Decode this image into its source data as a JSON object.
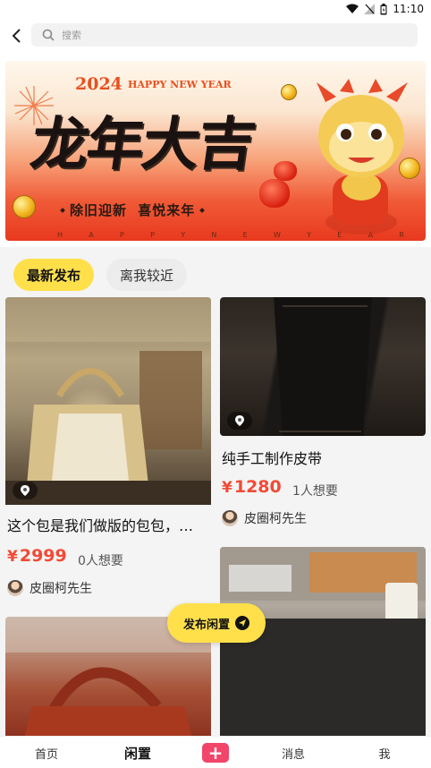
{
  "status_bar": {
    "time": "11:10"
  },
  "search": {
    "placeholder": "搜索"
  },
  "banner": {
    "year": "2024",
    "happy_new_year": "HAPPY NEW YEAR",
    "calligraphy": "龙年大吉",
    "slogan_left": "除旧迎新",
    "slogan_right": "喜悦来年",
    "bottom_letters": [
      "H",
      "A",
      "P",
      "P",
      "Y",
      "N",
      "E",
      "W",
      "Y",
      "E",
      "A",
      "R"
    ]
  },
  "tabs": [
    {
      "label": "最新发布",
      "active": true
    },
    {
      "label": "离我较近",
      "active": false
    }
  ],
  "cards": [
    {
      "title": "这个包是我们做版的包包，…",
      "price_symbol": "¥",
      "price": "2999",
      "wants": "0人想要",
      "seller": "皮圈柯先生"
    },
    {
      "title": "纯手工制作皮带",
      "price_symbol": "¥",
      "price": "1280",
      "wants": "1人想要",
      "seller": "皮圈柯先生"
    }
  ],
  "fab": {
    "label": "发布闲置"
  },
  "bottom_nav": {
    "home": "首页",
    "idle": "闲置",
    "plus": "+",
    "messages": "消息",
    "me": "我"
  },
  "colors": {
    "accent_yellow": "#ffe04b",
    "price_red": "#f24a36",
    "plus_pink": "#f2456a"
  },
  "icons": [
    "back-arrow-icon",
    "search-icon",
    "wifi-icon",
    "sim-icon",
    "battery-icon",
    "location-pin-icon",
    "send-icon",
    "plus-icon"
  ]
}
